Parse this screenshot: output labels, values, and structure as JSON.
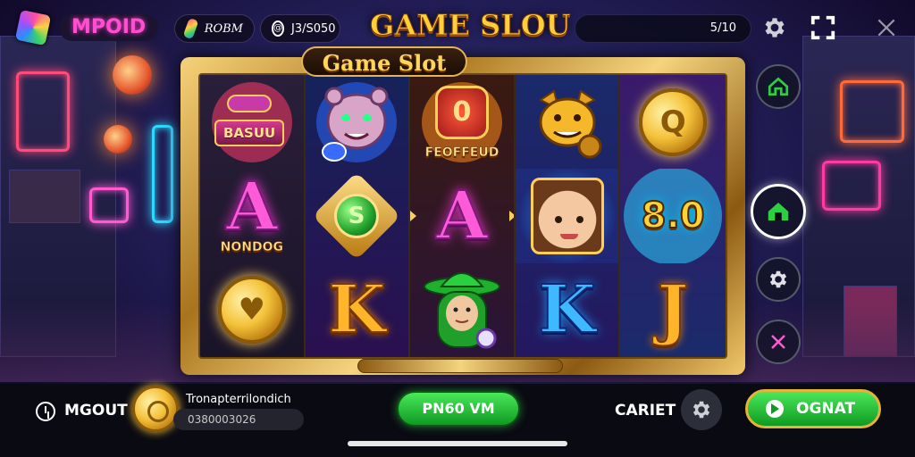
{
  "header": {
    "logo_text": "MPOID",
    "wallet_label": "ROBM",
    "account_label": "J3/S050",
    "game_title": "GAME SLOU",
    "progress_text": "5/10"
  },
  "frame": {
    "title": "Game Slot"
  },
  "reels": {
    "r1": {
      "s1_badge": "BASUU",
      "s2_letter": "A",
      "s2_caption": "NONDOG",
      "s3_symbol": "heart-coin"
    },
    "r2": {
      "s1_symbol": "tiger",
      "s2_symbol": "emerald",
      "s3_letter": "K"
    },
    "r3": {
      "s1_symbol": "fire-badge",
      "s1_caption": "FEOFFEUD",
      "s2_letter": "A",
      "s3_symbol": "green-hat-character"
    },
    "r4": {
      "s1_symbol": "golden-dog",
      "s2_symbol": "girl-portrait",
      "s3_letter": "K"
    },
    "r5": {
      "s1_symbol": "gold-coin",
      "s1_coin_letter": "Q",
      "s2_value": "8.0",
      "s3_letter": "J"
    }
  },
  "side_menu": {
    "items": [
      "home",
      "home-active",
      "settings",
      "close"
    ]
  },
  "bottom": {
    "timeout_label": "MGOUT",
    "balance_title": "Tronapterrilondich",
    "balance_value": "0380003026",
    "spin_label": "PN60 VM",
    "bet_label": "CARIET",
    "go_label": "OGNAT"
  },
  "colors": {
    "accent_gold": "#ffcf3a",
    "accent_green": "#1fb02e",
    "logo_pink": "#ff4fd1"
  }
}
